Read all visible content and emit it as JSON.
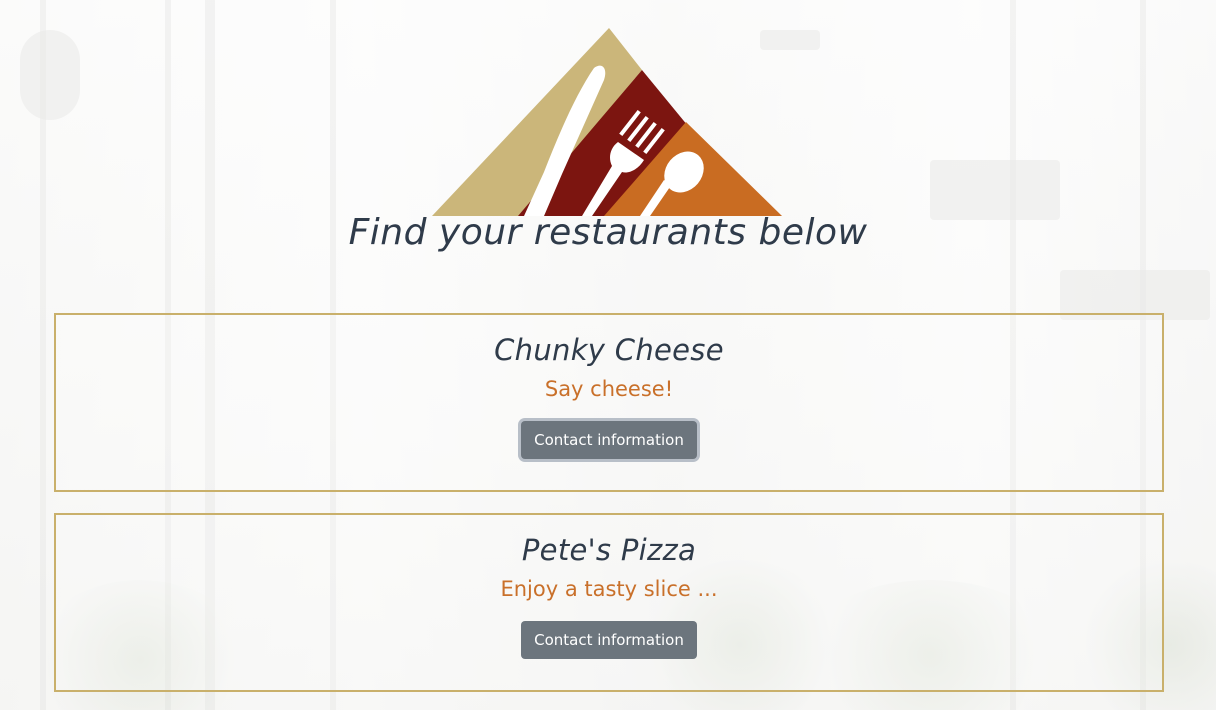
{
  "page": {
    "title": "Find your restaurants below"
  },
  "logo": {
    "icon": "knife-fork-spoon-triangle-logo",
    "colors": {
      "knife": "#cbb67a",
      "fork": "#7c1510",
      "spoon": "#c96c22"
    }
  },
  "restaurants": [
    {
      "name": "Chunky Cheese",
      "tagline": "Say cheese!",
      "button_label": "Contact information"
    },
    {
      "name": "Pete's Pizza",
      "tagline": "Enjoy a tasty slice ...",
      "button_label": "Contact information"
    }
  ],
  "colors": {
    "title_text": "#2f3b4a",
    "tagline_text": "#c9702a",
    "card_border": "#c9b06b",
    "button_bg": "#6c757d"
  }
}
